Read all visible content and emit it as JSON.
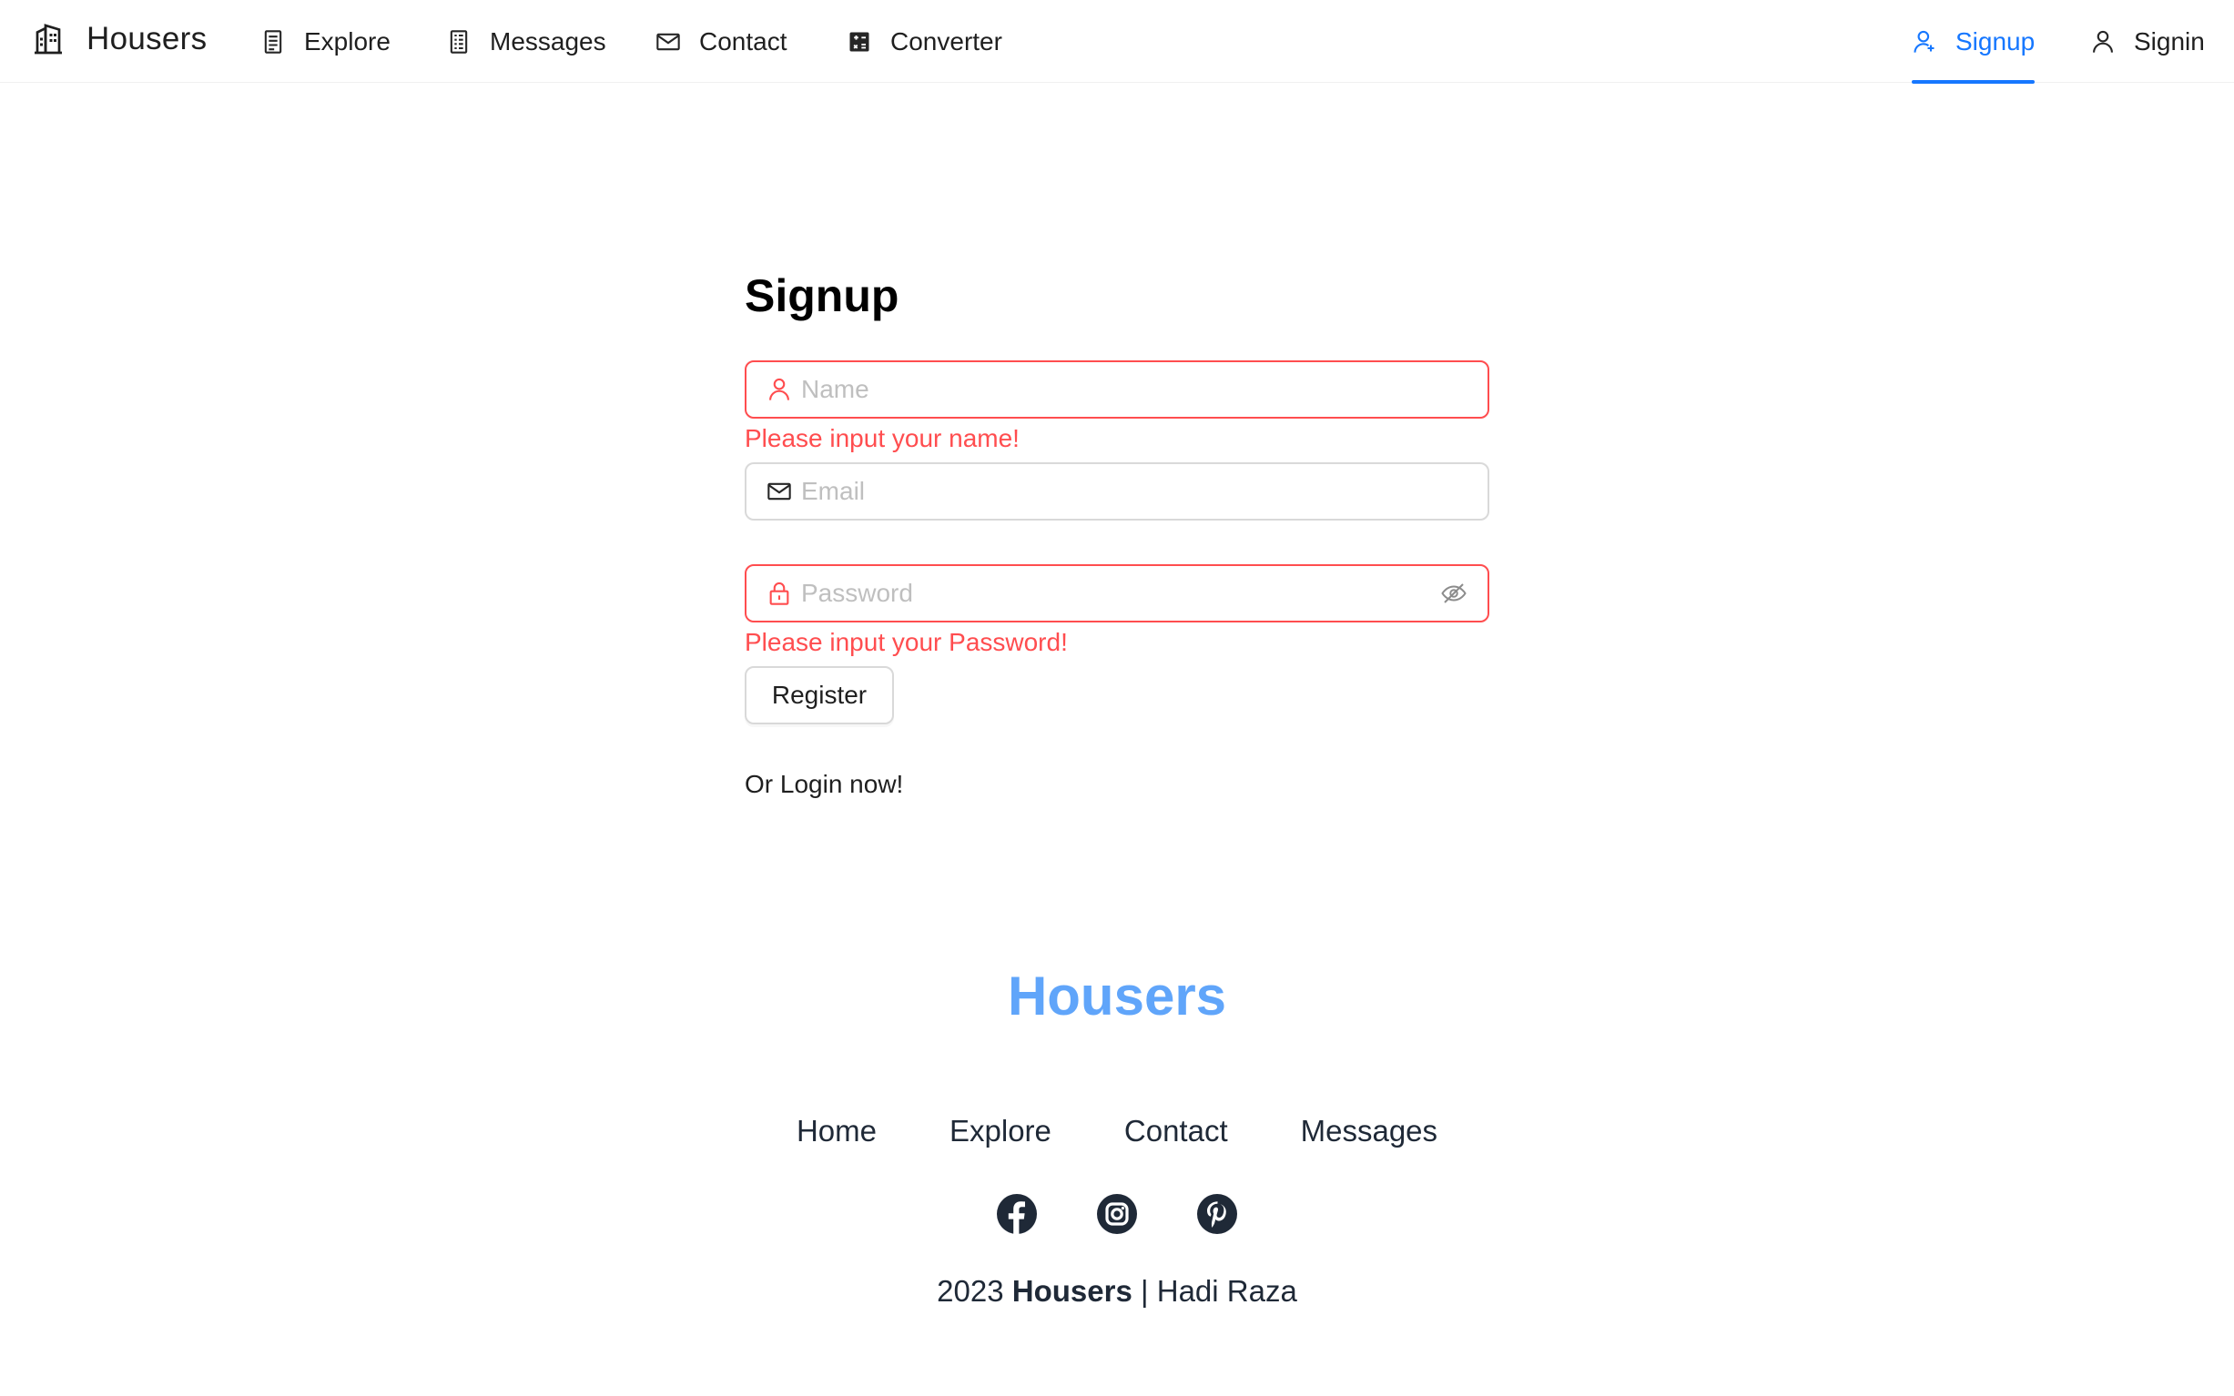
{
  "header": {
    "brand": "Housers",
    "nav": [
      {
        "label": "Explore",
        "icon": "document-icon"
      },
      {
        "label": "Messages",
        "icon": "list-document-icon"
      },
      {
        "label": "Contact",
        "icon": "mail-icon"
      },
      {
        "label": "Converter",
        "icon": "calculator-icon"
      }
    ],
    "auth": [
      {
        "label": "Signup",
        "icon": "user-add-icon",
        "active": true
      },
      {
        "label": "Signin",
        "icon": "user-icon",
        "active": false
      }
    ]
  },
  "form": {
    "title": "Signup",
    "name": {
      "placeholder": "Name",
      "value": "",
      "error": "Please input your name!"
    },
    "email": {
      "placeholder": "Email",
      "value": ""
    },
    "password": {
      "placeholder": "Password",
      "value": "",
      "error": "Please input your Password!"
    },
    "submit_label": "Register",
    "login_text": "Or Login now!"
  },
  "footer": {
    "brand": "Housers",
    "links": [
      "Home",
      "Explore",
      "Contact",
      "Messages"
    ],
    "socials": [
      "facebook-icon",
      "instagram-icon",
      "pinterest-icon"
    ],
    "copyright": {
      "year": "2023",
      "brand": "Housers",
      "separator": "|",
      "author": "Hadi Raza"
    }
  },
  "colors": {
    "accent": "#1677ff",
    "error": "#ff4d4f",
    "footer_brand": "#60a5fa",
    "text_dark": "#1f2937"
  }
}
